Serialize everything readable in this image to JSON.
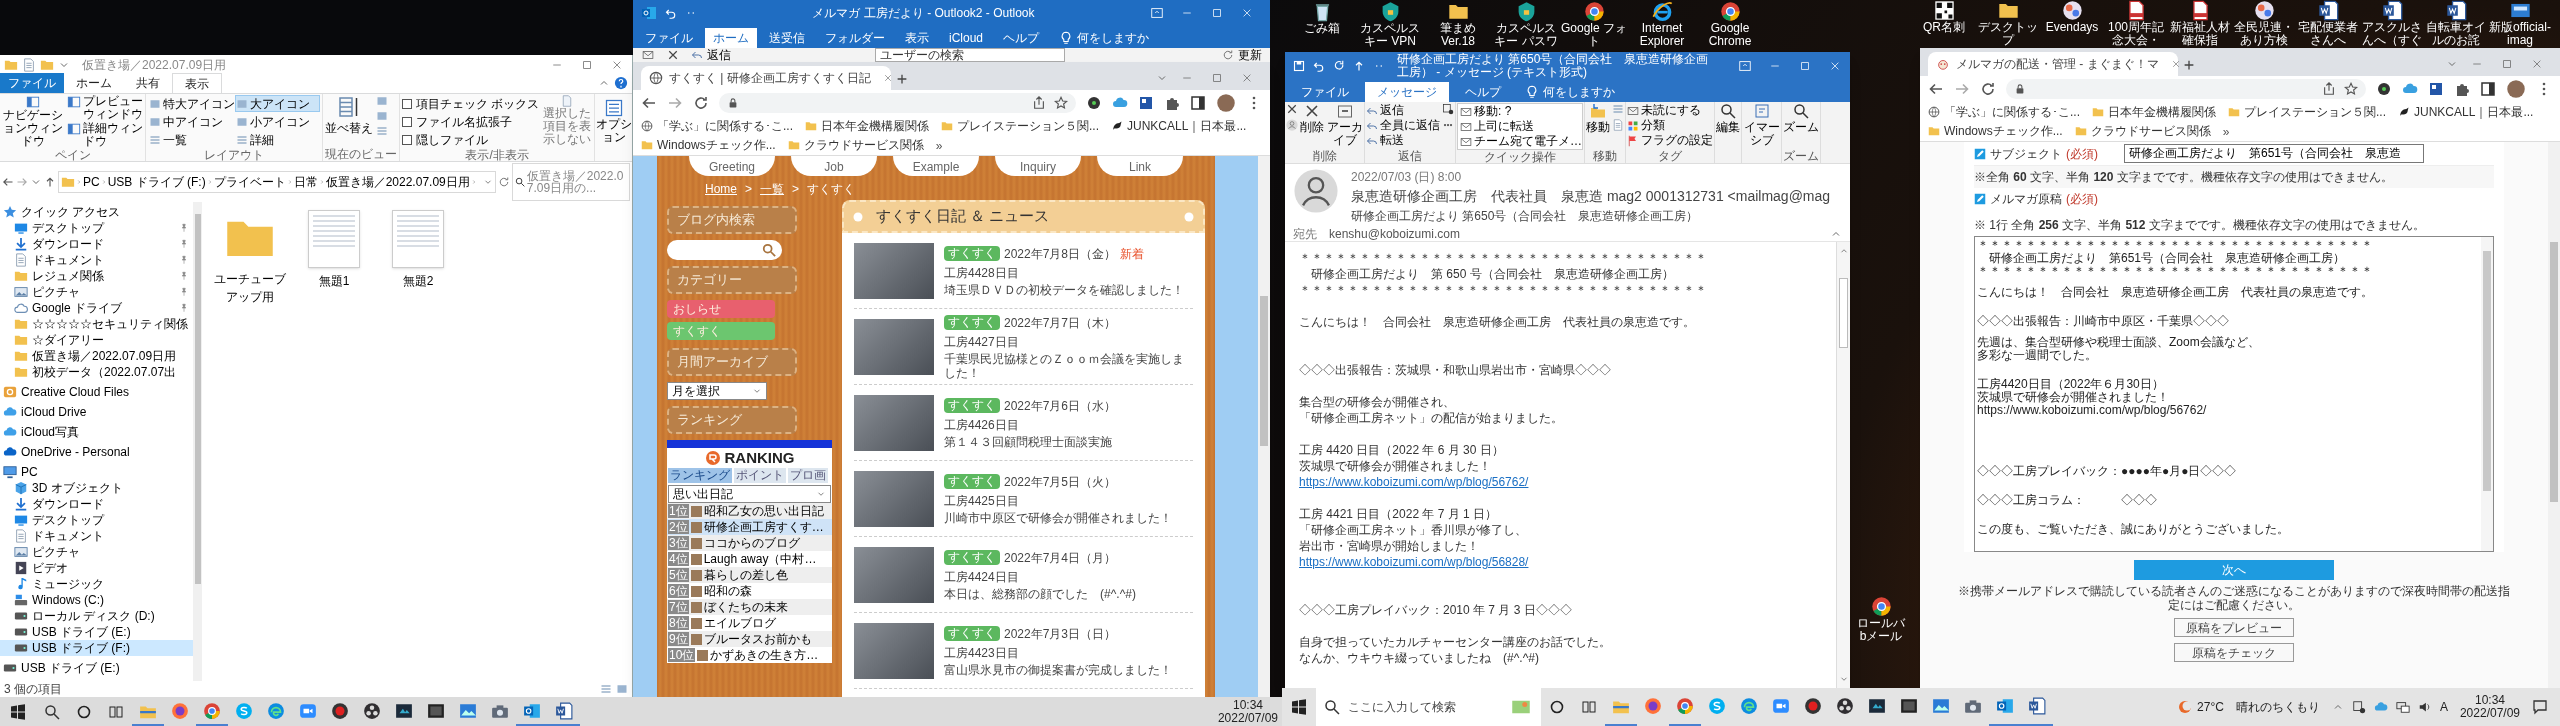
{
  "desktop_icons_top": [
    {
      "label": "ごみ箱",
      "kind": "bin"
    },
    {
      "label": "カスペルスキー VPN",
      "kind": "shield"
    },
    {
      "label": "筆まめVer.18",
      "kind": "folder"
    },
    {
      "label": "カスペルスキー パスワ",
      "kind": "shield"
    },
    {
      "label": "Google フォト",
      "kind": "chrome"
    },
    {
      "label": "Internet Explorer",
      "kind": "ie"
    },
    {
      "label": "Google Chrome",
      "kind": "chrome"
    }
  ],
  "desktop_icons_right": [
    {
      "label": "QR名刺",
      "kind": "qr"
    },
    {
      "label": "デスクトップ",
      "kind": "folder"
    },
    {
      "label": "Evendays",
      "kind": "app"
    },
    {
      "label": "100周年記念大会・",
      "kind": "pdf"
    },
    {
      "label": "新福祉人材確保指",
      "kind": "pdf"
    },
    {
      "label": "全民児連・あり方検",
      "kind": "app"
    },
    {
      "label": "宅配便業者さんへ",
      "kind": "word"
    },
    {
      "label": "アスクルさんへ（すぐ",
      "kind": "word"
    },
    {
      "label": "自転車オイルのお詫",
      "kind": "word"
    },
    {
      "label": "新版official-imag",
      "kind": "image"
    }
  ],
  "desktop_icon_lower": {
    "label": "ロールバbメール",
    "kind": "chrome"
  },
  "explorer": {
    "title": "仮置き場／2022.07.09日用",
    "tabs": [
      {
        "label": "ファイル",
        "kind": "file",
        "selected": false
      },
      {
        "label": "ホーム",
        "kind": "tab",
        "selected": false
      },
      {
        "label": "共有",
        "kind": "tab",
        "selected": false
      },
      {
        "label": "表示",
        "kind": "tab",
        "selected": true
      }
    ],
    "pane_group": "ペイン",
    "nav_pane": "ナビゲーションウィンドウ",
    "pane_items": [
      "プレビューウィンドウ",
      "詳細ウィンドウ"
    ],
    "layout_group": "レイアウト",
    "layouts": [
      {
        "label": "特大アイコン",
        "selected": false
      },
      {
        "label": "大アイコン",
        "selected": true
      },
      {
        "label": "中アイコン",
        "selected": false
      },
      {
        "label": "小アイコン",
        "selected": false
      },
      {
        "label": "一覧",
        "selected": false
      },
      {
        "label": "詳細",
        "selected": false
      }
    ],
    "view_group": "現在のビュー",
    "sort": "並べ替え",
    "show_group": "表示/非表示",
    "checks": [
      {
        "label": "項目チェック ボックス",
        "checked": false
      },
      {
        "label": "ファイル名拡張子",
        "checked": false
      },
      {
        "label": "隠しファイル",
        "checked": false
      }
    ],
    "hide_selected": "選択した項目を表示しない",
    "options": "オプション",
    "path": [
      "PC",
      "USB ドライブ (F:)",
      "プライベート",
      "日常",
      "仮置き場／2022.07.09日用"
    ],
    "search_placeholder": "仮置き場／2022.07.09日用の...",
    "nav": [
      {
        "label": "クイック アクセス",
        "kind": "star",
        "pinned": false,
        "selected": false,
        "children": [
          {
            "label": "デスクトップ",
            "kind": "desktop",
            "pinned": true,
            "selected": false
          },
          {
            "label": "ダウンロード",
            "kind": "download",
            "pinned": true,
            "selected": false
          },
          {
            "label": "ドキュメント",
            "kind": "document",
            "pinned": true,
            "selected": false
          },
          {
            "label": "レジュメ関係",
            "kind": "folder",
            "pinned": true,
            "selected": false
          },
          {
            "label": "ピクチャ",
            "kind": "picture",
            "pinned": true,
            "selected": false
          },
          {
            "label": "Google ドライブ",
            "kind": "cloud",
            "pinned": true,
            "selected": false
          },
          {
            "label": "☆☆☆☆☆セキュリティ関係",
            "kind": "folder",
            "pinned": false,
            "selected": false
          },
          {
            "label": "☆ダイアリー",
            "kind": "folder",
            "pinned": false,
            "selected": false
          },
          {
            "label": "仮置き場／2022.07.09日用",
            "kind": "folder",
            "pinned": false,
            "selected": false
          },
          {
            "label": "初校データ（2022.07.07出",
            "kind": "folder",
            "pinned": false,
            "selected": false
          }
        ]
      },
      {
        "label": "Creative Cloud Files",
        "kind": "cc",
        "pinned": false,
        "selected": false
      },
      {
        "label": "iCloud Drive",
        "kind": "icloud",
        "pinned": false,
        "selected": false
      },
      {
        "label": "iCloud写真",
        "kind": "icloud",
        "pinned": false,
        "selected": false
      },
      {
        "label": "OneDrive - Personal",
        "kind": "onedrive",
        "pinned": false,
        "selected": false
      },
      {
        "label": "PC",
        "kind": "pc",
        "pinned": false,
        "selected": false,
        "children": [
          {
            "label": "3D オブジェクト",
            "kind": "cube",
            "pinned": false,
            "selected": false
          },
          {
            "label": "ダウンロード",
            "kind": "download",
            "pinned": false,
            "selected": false
          },
          {
            "label": "デスクトップ",
            "kind": "desktop",
            "pinned": false,
            "selected": false
          },
          {
            "label": "ドキュメント",
            "kind": "document",
            "pinned": false,
            "selected": false
          },
          {
            "label": "ピクチャ",
            "kind": "picture",
            "pinned": false,
            "selected": false
          },
          {
            "label": "ビデオ",
            "kind": "video",
            "pinned": false,
            "selected": false
          },
          {
            "label": "ミュージック",
            "kind": "music",
            "pinned": false,
            "selected": false
          },
          {
            "label": "Windows (C:)",
            "kind": "windrive",
            "pinned": false,
            "selected": false
          },
          {
            "label": "ローカル ディスク (D:)",
            "kind": "drive",
            "pinned": false,
            "selected": false
          },
          {
            "label": "USB ドライブ (E:)",
            "kind": "drive",
            "pinned": false,
            "selected": false
          },
          {
            "label": "USB ドライブ (F:)",
            "kind": "drive",
            "pinned": false,
            "selected": true
          }
        ]
      },
      {
        "label": "USB ドライブ (E:)",
        "kind": "drive",
        "pinned": false,
        "selected": false
      }
    ],
    "files": [
      {
        "name": "ユーチューブアップ用",
        "kind": "folder"
      },
      {
        "name": "無題1",
        "kind": "document"
      },
      {
        "name": "無題2",
        "kind": "document"
      }
    ],
    "status": "3 個の項目"
  },
  "outlook_main": {
    "title": "メルマガ 工房だより - Outlook2 - Outlook",
    "tabs": [
      {
        "label": "ファイル",
        "selected": false
      },
      {
        "label": "ホーム",
        "selected": true
      },
      {
        "label": "送受信",
        "selected": false
      },
      {
        "label": "フォルダー",
        "selected": false
      },
      {
        "label": "表示",
        "selected": false
      },
      {
        "label": "iCloud",
        "selected": false
      },
      {
        "label": "ヘルプ",
        "selected": false
      }
    ],
    "tell_me": "何をしますか",
    "reply": "返信",
    "people_search_placeholder": "ユーザーの検索",
    "update": "更新"
  },
  "browser_left": {
    "tab_title": "すくすく | 研修企画工房すくすく日記",
    "bookmarks": [
      {
        "label": "「学ぶ」に関係する･こ...",
        "kind": "globe"
      },
      {
        "label": "日本年金機構履関係",
        "kind": "folder"
      },
      {
        "label": "プレイステーション５関...",
        "kind": "folder"
      },
      {
        "label": "JUNKCALL｜日本最...",
        "kind": "bird"
      },
      {
        "label": "Windowsチェック作...",
        "kind": "folder"
      },
      {
        "label": "クラウドサービス関係",
        "kind": "folder"
      }
    ],
    "more": "»",
    "site": {
      "nav": [
        "Greeting",
        "Job",
        "Example",
        "Inquiry",
        "Link"
      ],
      "breadcrumb": [
        {
          "label": "Home",
          "kind": "link"
        },
        {
          "label": ">",
          "kind": "sep"
        },
        {
          "label": "一覧",
          "kind": "link"
        },
        {
          "label": ">",
          "kind": "sep"
        },
        {
          "label": "すくすく",
          "kind": "current"
        }
      ],
      "search_heading": "ブログ内検索",
      "category_heading": "カテゴリー",
      "categories": [
        {
          "label": "おしらせ",
          "color": "#e8606e"
        },
        {
          "label": "すくすく",
          "color": "#6cc66f"
        }
      ],
      "archive_heading": "月間アーカイブ",
      "month_select": "月を選択",
      "ranking_heading": "ランキング",
      "ranking": {
        "logo": "RANKING",
        "tabs": [
          {
            "label": "ランキング",
            "selected": true
          },
          {
            "label": "ポイント",
            "selected": false
          },
          {
            "label": "プロ画",
            "selected": false
          }
        ],
        "genre": "思い出日記",
        "entries": [
          {
            "rank": "1位",
            "title": "昭和乙女の思い出日記",
            "selected": false
          },
          {
            "rank": "2位",
            "title": "研修企画工房すくす…",
            "selected": true
          },
          {
            "rank": "3位",
            "title": "ココからのブログ",
            "selected": false
          },
          {
            "rank": "4位",
            "title": "Laugh away（中村…",
            "selected": false
          },
          {
            "rank": "5位",
            "title": "暮らしの差し色",
            "selected": false
          },
          {
            "rank": "6位",
            "title": "昭和の森",
            "selected": false
          },
          {
            "rank": "7位",
            "title": "ぼくたちの未来",
            "selected": false
          },
          {
            "rank": "8位",
            "title": "エイルブログ",
            "selected": false
          },
          {
            "rank": "9位",
            "title": "ブルータスお前かも",
            "selected": false
          },
          {
            "rank": "10位",
            "title": "かずあきの生き方…",
            "selected": false
          }
        ]
      },
      "news_title": "すくすく日記 ＆ ニュース",
      "posts": [
        {
          "tag": "すくすく",
          "date": "2022年7月8日（金）",
          "new": "新着",
          "title": "工房4428日目",
          "body": "埼玉県ＤＶＤの初校データを確認しました！"
        },
        {
          "tag": "すくすく",
          "date": "2022年7月7日（木）",
          "title": "工房4427日目",
          "body": "千葉県民児協様とのＺｏｏｍ会議を実施しました！"
        },
        {
          "tag": "すくすく",
          "date": "2022年7月6日（水）",
          "title": "工房4426日目",
          "body": "第１４３回顧問税理士面談実施"
        },
        {
          "tag": "すくすく",
          "date": "2022年7月5日（火）",
          "title": "工房4425日目",
          "body": "川崎市中原区で研修会が開催されました！"
        },
        {
          "tag": "すくすく",
          "date": "2022年7月4日（月）",
          "title": "工房4424日目",
          "body": "本日は、総務部の顔でした　(#^.^#)"
        },
        {
          "tag": "すくすく",
          "date": "2022年7月3日（日）",
          "title": "工房4423日目",
          "body": "富山県氷見市の御提案書が完成しました！"
        }
      ]
    }
  },
  "outlook_message": {
    "title": "研修企画工房だより 第650号（合同会社　泉恵造研修企画工房） - メッセージ (テキスト形式)",
    "tabs": [
      {
        "label": "ファイル",
        "selected": false
      },
      {
        "label": "メッセージ",
        "selected": true
      },
      {
        "label": "ヘルプ",
        "selected": false
      }
    ],
    "tell_me": "何をしますか",
    "ribbon": {
      "delete_group": "削除",
      "delete": "削除",
      "archive": "アーカイブ",
      "respond_group": "返信",
      "respond": [
        "返信",
        "全員に返信",
        "転送"
      ],
      "quick_group": "クイック操作",
      "quick": [
        "移動: ?",
        "上司に転送",
        "チーム宛て電子メ…"
      ],
      "move_group": "移動",
      "move": "移動",
      "tags_group": "タグ",
      "tags": [
        "未読にする",
        "分類",
        "フラグの設定"
      ],
      "edit": "編集",
      "immersive": "イマーシブ",
      "zoom": "ズーム",
      "zoom_group": "ズーム"
    },
    "header": {
      "date": "2022/07/03 (日) 8:00",
      "sender": "泉恵造研修企画工房　代表社員　泉恵造 mag2 0001312731 <mailmag@mag",
      "subject": "研修企画工房だより 第650号（合同会社　泉恵造研修企画工房）",
      "to_label": "宛先",
      "to": "kenshu@koboizumi.com"
    },
    "body": [
      {
        "kind": "text",
        "text": "＊＊＊＊＊＊＊＊＊＊＊＊＊＊＊＊＊＊＊＊＊＊＊＊＊＊＊＊＊＊＊＊＊＊"
      },
      {
        "kind": "text",
        "text": "　研修企画工房だより　第 650 号（合同会社　泉恵造研修企画工房）"
      },
      {
        "kind": "text",
        "text": "＊＊＊＊＊＊＊＊＊＊＊＊＊＊＊＊＊＊＊＊＊＊＊＊＊＊＊＊＊＊＊＊＊＊"
      },
      {
        "kind": "gap"
      },
      {
        "kind": "text",
        "text": "こんにちは！　合同会社　泉恵造研修企画工房　代表社員の泉恵造です。"
      },
      {
        "kind": "gap"
      },
      {
        "kind": "gap"
      },
      {
        "kind": "text",
        "text": "◇◇◇出張報告：茨城県・和歌山県岩出市・宮崎県◇◇◇"
      },
      {
        "kind": "gap"
      },
      {
        "kind": "text",
        "text": "集合型の研修会が開催され、"
      },
      {
        "kind": "text",
        "text": "「研修企画工房ネット」の配信が始まりました。"
      },
      {
        "kind": "gap"
      },
      {
        "kind": "text",
        "text": "工房 4420 日目（2022 年 6 月 30 日）"
      },
      {
        "kind": "text",
        "text": "茨城県で研修会が開催されました！"
      },
      {
        "kind": "link",
        "text": "https://www.koboizumi.com/wp/blog/56762/"
      },
      {
        "kind": "gap"
      },
      {
        "kind": "text",
        "text": "工房 4421 日目（2022 年 7 月 1 日）"
      },
      {
        "kind": "text",
        "text": "「研修企画工房ネット」香川県が修了し、"
      },
      {
        "kind": "text",
        "text": "岩出市・宮崎県が開始しました！"
      },
      {
        "kind": "link",
        "text": "https://www.koboizumi.com/wp/blog/56828/"
      },
      {
        "kind": "gap"
      },
      {
        "kind": "gap"
      },
      {
        "kind": "text",
        "text": "◇◇◇工房プレイバック：2010 年 7 月 3 日◇◇◇"
      },
      {
        "kind": "gap"
      },
      {
        "kind": "text",
        "text": "自身で担っていたカルチャーセンター講座のお話でした。"
      },
      {
        "kind": "text",
        "text": "なんか、ウキウキ綴っていましたね　(#^.^#)"
      }
    ]
  },
  "browser_right": {
    "tab_title": "メルマガの配送・管理 - まぐまぐ！マ",
    "bookmarks": [
      {
        "label": "「学ぶ」に関係する･こ...",
        "kind": "globe"
      },
      {
        "label": "日本年金機構履関係",
        "kind": "folder"
      },
      {
        "label": "プレイステーション５関...",
        "kind": "folder"
      },
      {
        "label": "JUNKCALL｜日本最...",
        "kind": "bird"
      },
      {
        "label": "Windowsチェック作...",
        "kind": "folder"
      },
      {
        "label": "クラウドサービス関係",
        "kind": "folder"
      }
    ],
    "more": "»",
    "form": {
      "subject_label": "サブジェクト",
      "subject_required": "(必須)",
      "subject_value": "研修企画工房だより　第651号（合同会社　泉恵造",
      "subject_note": "※全角 **60** 文字、半角 **120** 文字までです。機種依存文字の使用はできません。",
      "body_label": "メルマガ原稿",
      "body_required": "(必須)",
      "body_note": "※ 1行 全角 **256** 文字、半角 **512** 文字までです。機種依存文字の使用はできません。",
      "manuscript": [
        {
          "kind": "text",
          "text": "＊＊＊＊＊＊＊＊＊＊＊＊＊＊＊＊＊＊＊＊＊＊＊＊＊＊＊＊＊＊＊＊＊"
        },
        {
          "kind": "text",
          "text": "　研修企画工房だより　第651号（合同会社　泉恵造研修企画工房）"
        },
        {
          "kind": "text",
          "text": "＊＊＊＊＊＊＊＊＊＊＊＊＊＊＊＊＊＊＊＊＊＊＊＊＊＊＊＊＊＊＊＊＊"
        },
        {
          "kind": "gap"
        },
        {
          "kind": "text",
          "text": "こんにちは！　合同会社　泉恵造研修企画工房　代表社員の泉恵造です。"
        },
        {
          "kind": "gap"
        },
        {
          "kind": "gap"
        },
        {
          "kind": "text",
          "text": "◇◇◇出張報告：川崎市中原区・千葉県◇◇◇"
        },
        {
          "kind": "gap"
        },
        {
          "kind": "text",
          "text": "先週は、集合型研修や税理士面談、Zoom会議など、"
        },
        {
          "kind": "text",
          "text": "多彩な一週間でした。"
        },
        {
          "kind": "gap"
        },
        {
          "kind": "gap"
        },
        {
          "kind": "text",
          "text": "工房4420日目（2022年６月30日）"
        },
        {
          "kind": "text",
          "text": "茨城県で研修会が開催されました！"
        },
        {
          "kind": "text",
          "text": "https://www.koboizumi.com/wp/blog/56762/"
        },
        {
          "kind": "gap"
        },
        {
          "kind": "gap"
        },
        {
          "kind": "gap"
        },
        {
          "kind": "gap"
        },
        {
          "kind": "gap"
        },
        {
          "kind": "gap"
        },
        {
          "kind": "text",
          "text": "◇◇◇工房プレイバック：●●●●年●月●日◇◇◇"
        },
        {
          "kind": "gap"
        },
        {
          "kind": "gap"
        },
        {
          "kind": "text",
          "text": "◇◇◇工房コラム：　　　◇◇◇"
        },
        {
          "kind": "gap"
        },
        {
          "kind": "gap"
        },
        {
          "kind": "text",
          "text": "この度も、ご覧いただき、誠にありがとうございました。"
        }
      ],
      "next": "次へ",
      "night_note": "※携帯メールアドレスで購読している読者さんのご迷惑になることがありますので深夜時間帯の配送指定にはご配慮ください。",
      "preview": "原稿をプレビュー",
      "check": "原稿をチェック"
    }
  },
  "taskbar_left": {
    "apps": [
      {
        "kind": "explorer",
        "active": true
      },
      {
        "kind": "firefox",
        "active": false
      },
      {
        "kind": "chrome",
        "active": true
      },
      {
        "kind": "skype",
        "active": false
      },
      {
        "kind": "edge",
        "active": false
      },
      {
        "kind": "zoom",
        "active": false
      },
      {
        "kind": "record",
        "active": false
      },
      {
        "kind": "obs",
        "active": false
      },
      {
        "kind": "capture",
        "active": false
      },
      {
        "kind": "terminal",
        "active": false
      },
      {
        "kind": "photos",
        "active": false
      },
      {
        "kind": "camera",
        "active": false
      },
      {
        "kind": "outlook",
        "active": true
      },
      {
        "kind": "word",
        "active": true
      }
    ],
    "time": "10:34",
    "date": "2022/07/09"
  },
  "taskbar_right": {
    "search_placeholder": "ここに入力して検索",
    "apps": [
      {
        "kind": "explorer",
        "active": true
      },
      {
        "kind": "firefox",
        "active": false
      },
      {
        "kind": "chrome",
        "active": true
      },
      {
        "kind": "skype",
        "active": false
      },
      {
        "kind": "edge",
        "active": false
      },
      {
        "kind": "zoom",
        "active": false
      },
      {
        "kind": "record",
        "active": false
      },
      {
        "kind": "obs",
        "active": false
      },
      {
        "kind": "capture",
        "active": false
      },
      {
        "kind": "terminal",
        "active": false
      },
      {
        "kind": "photos",
        "active": false
      },
      {
        "kind": "camera",
        "active": false
      },
      {
        "kind": "outlook",
        "active": true
      },
      {
        "kind": "word",
        "active": true
      }
    ],
    "weather": "27°C　晴れのちくもり",
    "ime": "A",
    "time": "10:34",
    "date": "2022/07/09"
  }
}
